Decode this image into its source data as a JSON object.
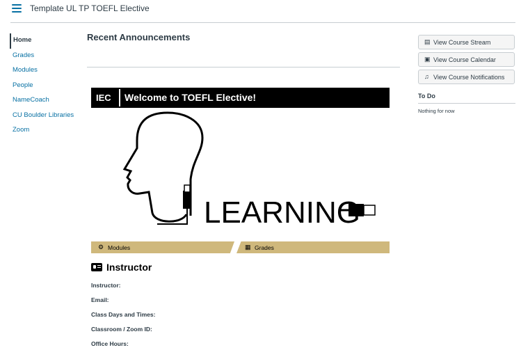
{
  "header": {
    "breadcrumb": "Template UL TP TOEFL Elective"
  },
  "nav": {
    "items": [
      "Home",
      "Grades",
      "Modules",
      "People",
      "NameCoach",
      "CU Boulder Libraries",
      "Zoom"
    ]
  },
  "main": {
    "title": "Recent Announcements",
    "banner": {
      "tag": "IEC",
      "welcome": "Welcome to TOEFL Elective!"
    },
    "image_text": "LEARNING",
    "tabs": [
      {
        "label": "Modules",
        "icon": "modules-icon"
      },
      {
        "label": "Grades",
        "icon": "calculator-icon"
      }
    ],
    "instructor": {
      "heading": "Instructor",
      "fields": [
        "Instructor:",
        "Email:",
        "Class Days and Times:",
        "Classroom / Zoom ID:",
        "Office Hours:"
      ]
    }
  },
  "sidebar": {
    "buttons": [
      {
        "label": "View Course Stream",
        "icon": "stream-icon"
      },
      {
        "label": "View Course Calendar",
        "icon": "calendar-icon"
      },
      {
        "label": "View Course Notifications",
        "icon": "bell-icon"
      }
    ],
    "todo": {
      "heading": "To Do",
      "empty": "Nothing for now"
    }
  },
  "colors": {
    "accent": "#cfb87c",
    "link": "#0770a3",
    "banner": "#000000"
  }
}
